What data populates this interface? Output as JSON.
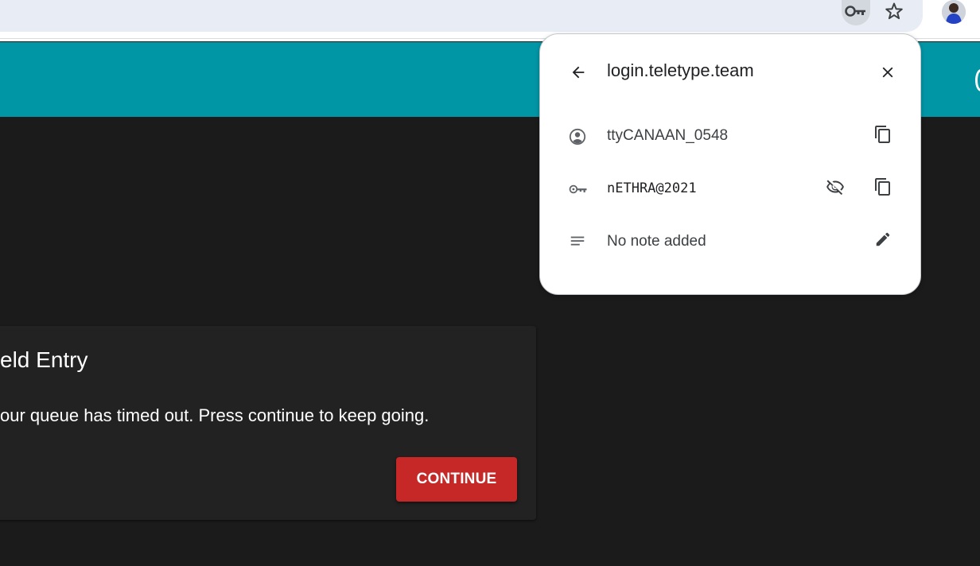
{
  "popup": {
    "site": "login.teletype.team",
    "username": "ttyCANAAN_0548",
    "password": "nETHRA@2021",
    "note": "No note added"
  },
  "dialog": {
    "title": "eld Entry",
    "message": "our queue has timed out. Press continue to keep going.",
    "continue_label": "CONTINUE"
  },
  "icons": {
    "toolbar": [
      "key-icon",
      "star-icon",
      "avatar"
    ],
    "popup": [
      "back-arrow-icon",
      "close-icon",
      "account-circle-icon",
      "copy-icon",
      "key-icon",
      "visibility-off-icon",
      "notes-icon",
      "edit-icon"
    ]
  },
  "colors": {
    "header": "#0096a6",
    "page_background": "#1b1b1b",
    "dialog_background": "#222222",
    "continue_button": "#c62828"
  }
}
